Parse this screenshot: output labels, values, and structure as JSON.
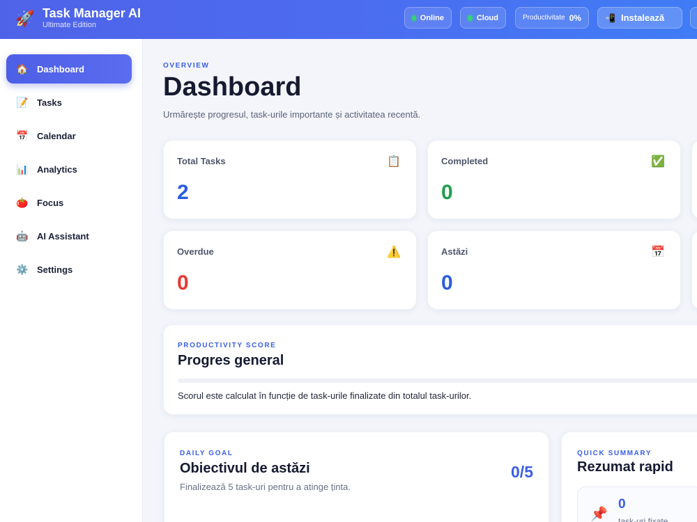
{
  "header": {
    "brand_icon": "rocket-icon",
    "title": "Task Manager AI",
    "subtitle": "Ultimate Edition",
    "status_online": "Online",
    "status_cloud": "Cloud",
    "productivity_label": "Productivitate",
    "productivity_value": "0%",
    "install_label": "Instalează",
    "accent": "#4f63e8"
  },
  "sidebar": {
    "items": [
      {
        "label": "Dashboard",
        "icon": "house-icon",
        "active": true
      },
      {
        "label": "Tasks",
        "icon": "memo-icon"
      },
      {
        "label": "Calendar",
        "icon": "calendar-icon"
      },
      {
        "label": "Analytics",
        "icon": "bar-chart-icon"
      },
      {
        "label": "Focus",
        "icon": "tomato-icon"
      },
      {
        "label": "AI Assistant",
        "icon": "robot-icon"
      },
      {
        "label": "Settings",
        "icon": "gear-icon"
      }
    ]
  },
  "page": {
    "eyebrow": "OVERVIEW",
    "title": "Dashboard",
    "subtitle": "Urmărește progresul, task-urile importante și activitatea recentă."
  },
  "stats": [
    {
      "label": "Total Tasks",
      "value": "2",
      "icon": "clipboard-icon",
      "color": "#2b5ce0"
    },
    {
      "label": "Completed",
      "value": "0",
      "icon": "check-icon",
      "color": "#1f9d4c"
    },
    {
      "label": "Overdue",
      "value": "0",
      "icon": "warning-icon",
      "color": "#e53935"
    },
    {
      "label": "Astăzi",
      "value": "0",
      "icon": "calendar-icon",
      "color": "#2b5ce0"
    }
  ],
  "productivity": {
    "eyebrow": "PRODUCTIVITY SCORE",
    "title": "Progres general",
    "progress": 0,
    "description": "Scorul este calculat în funcție de task-urile finalizate din totalul task-urilor."
  },
  "daily_goal": {
    "eyebrow": "DAILY GOAL",
    "title": "Obiectivul de astăzi",
    "count": "0/5",
    "description": "Finalizează 5 task-uri pentru a atinge ținta."
  },
  "quick_summary": {
    "eyebrow": "QUICK SUMMARY",
    "title": "Rezumat rapid",
    "pinned_value": "0",
    "pinned_label": "task-uri fixate",
    "icon": "pushpin-icon"
  }
}
